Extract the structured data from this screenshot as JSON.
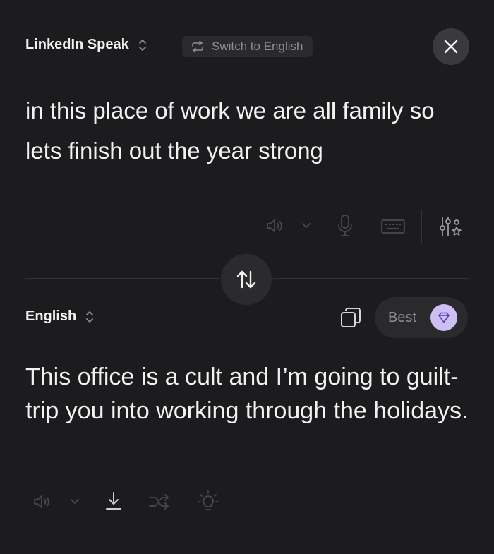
{
  "source": {
    "language": "LinkedIn Speak",
    "switch_label": "Switch to English",
    "text": "in this place of work we are all family so lets finish out the year strong"
  },
  "target": {
    "language": "English",
    "best_label": "Best",
    "text": "This office is a cult and I’m going to guilt-trip you into working through the holidays."
  },
  "icons": {
    "source_toolbar": [
      "speaker-icon",
      "chevron-down-icon",
      "microphone-icon",
      "keyboard-icon",
      "settings-sliders-icon"
    ],
    "target_toolbar": [
      "speaker-icon",
      "chevron-down-icon",
      "download-icon",
      "shuffle-icon",
      "lightbulb-icon"
    ],
    "other": [
      "close-icon",
      "swap-arrows-icon",
      "copy-icon",
      "diamond-icon",
      "switch-arrows-icon",
      "chevron-updown-icon"
    ]
  },
  "colors": {
    "background": "#1c1c1e",
    "text": "#f2f2f2",
    "muted": "#8e8e93",
    "pill": "#2a2a2d",
    "accent": "#cdbff4"
  }
}
